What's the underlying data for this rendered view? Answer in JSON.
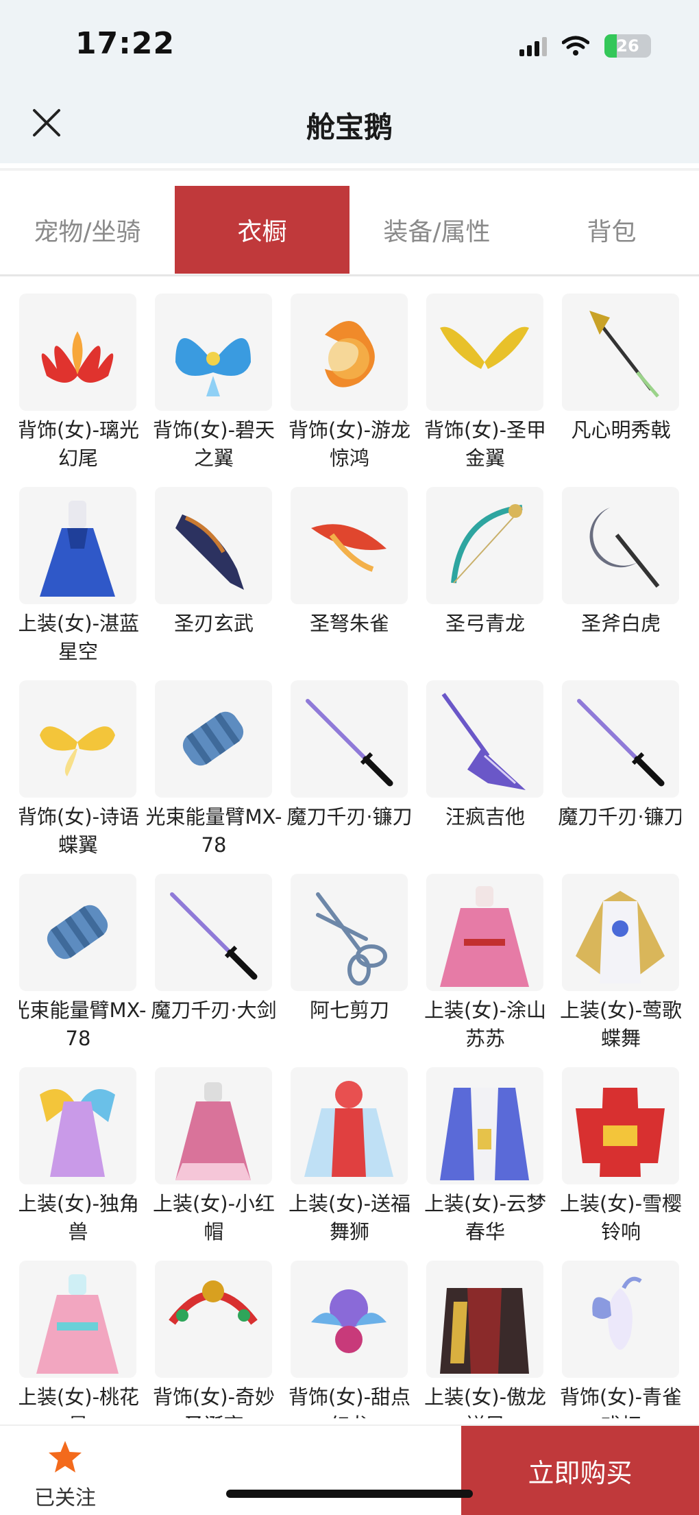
{
  "status": {
    "time": "17:22",
    "battery": "26"
  },
  "header": {
    "title": "舱宝鹅"
  },
  "tabs": [
    {
      "label": "宠物/坐骑",
      "active": false
    },
    {
      "label": "衣橱",
      "active": true
    },
    {
      "label": "装备/属性",
      "active": false
    },
    {
      "label": "背包",
      "active": false
    }
  ],
  "items": [
    {
      "name": "背饰(女)-璃光幻尾",
      "icon": "red-wings",
      "color": "#e0332e"
    },
    {
      "name": "背饰(女)-碧天之翼",
      "icon": "blue-wings",
      "color": "#3a9be0"
    },
    {
      "name": "背饰(女)-游龙惊鸿",
      "icon": "orange-dragon",
      "color": "#f08a2a"
    },
    {
      "name": "背饰(女)-圣甲金翼",
      "icon": "gold-wings",
      "color": "#e8c12a"
    },
    {
      "name": "凡心明秀戟",
      "icon": "halberd",
      "color": "#c9a227"
    },
    {
      "name": "上装(女)-湛蓝星空",
      "icon": "blue-dress",
      "color": "#2f58c8"
    },
    {
      "name": "圣刃玄武",
      "icon": "dark-blade",
      "color": "#2c3260"
    },
    {
      "name": "圣弩朱雀",
      "icon": "red-crossbow",
      "color": "#e0462e"
    },
    {
      "name": "圣弓青龙",
      "icon": "dragon-bow",
      "color": "#2ea5a0"
    },
    {
      "name": "圣斧白虎",
      "icon": "moon-axe",
      "color": "#6a6e80"
    },
    {
      "name": "背饰(女)-诗语蝶翼",
      "icon": "butterfly-wings",
      "color": "#f3c53a"
    },
    {
      "name": "光束能量臂MX-78",
      "icon": "energy-arm",
      "color": "#5d8cc0"
    },
    {
      "name": "魔刀千刃·镰刀",
      "icon": "katana",
      "color": "#8f7ad8"
    },
    {
      "name": "汪疯吉他",
      "icon": "guitar",
      "color": "#6a57c8"
    },
    {
      "name": "魔刀千刃·镰刀",
      "icon": "katana",
      "color": "#8f7ad8"
    },
    {
      "name": "光束能量臂MX-78",
      "icon": "energy-arm",
      "color": "#5d8cc0"
    },
    {
      "name": "魔刀千刃·大剑",
      "icon": "katana",
      "color": "#8f7ad8"
    },
    {
      "name": "阿七剪刀",
      "icon": "scissors",
      "color": "#6d87a8"
    },
    {
      "name": "上装(女)-涂山苏苏",
      "icon": "pink-robe",
      "color": "#e67ba6"
    },
    {
      "name": "上装(女)-莺歌蝶舞",
      "icon": "gold-robe",
      "color": "#d9b65a"
    },
    {
      "name": "上装(女)-独角兽",
      "icon": "unicorn-dress",
      "color": "#c99ae8"
    },
    {
      "name": "上装(女)-小红帽",
      "icon": "pink-dress",
      "color": "#d9739a"
    },
    {
      "name": "上装(女)-送福舞狮",
      "icon": "lion-costume",
      "color": "#e04040"
    },
    {
      "name": "上装(女)-云梦春华",
      "icon": "purple-robe",
      "color": "#5a6ad8"
    },
    {
      "name": "上装(女)-雪樱铃响",
      "icon": "red-kimono",
      "color": "#d83030"
    },
    {
      "name": "上装(女)-桃花星",
      "icon": "peach-dress",
      "color": "#f2a6c0"
    },
    {
      "name": "背饰(女)-奇妙圣诞夜",
      "icon": "xmas-wreath",
      "color": "#d8a020"
    },
    {
      "name": "背饰(女)-甜点幻龙",
      "icon": "baby-dragon",
      "color": "#6ab0e8"
    },
    {
      "name": "上装(女)-傲龙祥凤",
      "icon": "dark-robe",
      "color": "#8a2a2a"
    },
    {
      "name": "背饰(女)-青雀戏灯",
      "icon": "blue-bird",
      "color": "#8a9ae0"
    }
  ],
  "bottom": {
    "follow_label": "已关注",
    "buy_label": "立即购买"
  }
}
